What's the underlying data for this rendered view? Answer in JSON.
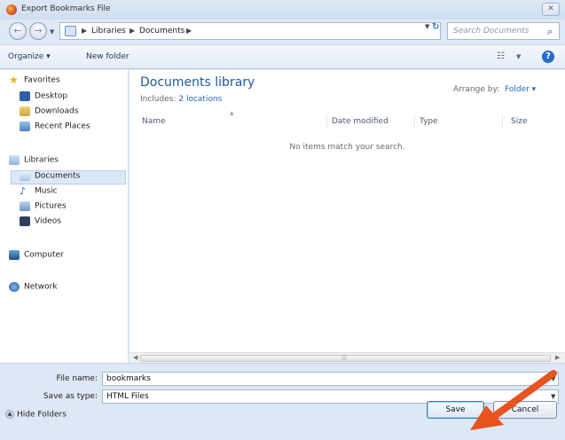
{
  "window": {
    "title": "Export Bookmarks File",
    "close_glyph": "✕"
  },
  "address": {
    "crumbs": [
      "Libraries",
      "Documents"
    ],
    "search_placeholder": "Search Documents"
  },
  "toolbar": {
    "organize": "Organize ▾",
    "new_folder": "New folder"
  },
  "nav": {
    "items": [
      {
        "label": "Favorites",
        "icon": "star-icon"
      },
      {
        "label": "Desktop",
        "icon": "desktop-icon"
      },
      {
        "label": "Downloads",
        "icon": "downloads-icon"
      },
      {
        "label": "Recent Places",
        "icon": "recent-places-icon"
      },
      {
        "label": "Libraries",
        "icon": "libraries-icon"
      },
      {
        "label": "Documents",
        "icon": "documents-icon"
      },
      {
        "label": "Music",
        "icon": "music-icon"
      },
      {
        "label": "Pictures",
        "icon": "pictures-icon"
      },
      {
        "label": "Videos",
        "icon": "videos-icon"
      },
      {
        "label": "Computer",
        "icon": "computer-icon"
      },
      {
        "label": "Network",
        "icon": "network-icon"
      }
    ],
    "selected": "Documents"
  },
  "library": {
    "title": "Documents library",
    "includes_label": "Includes:",
    "includes_link": "2 locations",
    "arrange_label": "Arrange by:",
    "arrange_value": "Folder ▾"
  },
  "columns": [
    "Name",
    "Date modified",
    "Type",
    "Size"
  ],
  "empty_message": "No items match your search.",
  "form": {
    "file_name_label": "File name:",
    "file_name_value": "bookmarks",
    "save_type_label": "Save as type:",
    "save_type_value": "HTML Files"
  },
  "footer": {
    "hide_folders": "Hide Folders",
    "save": "Save",
    "cancel": "Cancel"
  },
  "colors": {
    "annotation_arrow": "#e8531f",
    "accent": "#1e5a9c"
  }
}
